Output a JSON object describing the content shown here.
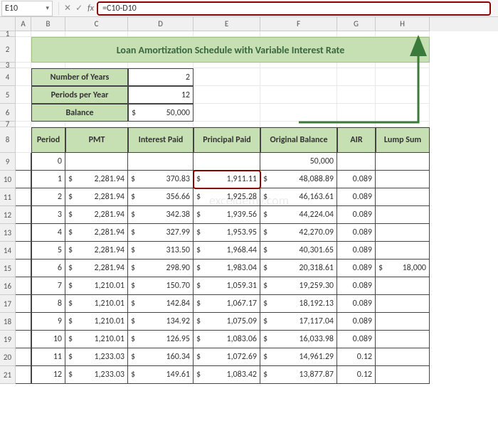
{
  "nameBox": "E10",
  "formula": "=C10-D10",
  "fx": "fx",
  "btnX": "✕",
  "btnV": "✓",
  "cols": {
    "A": "A",
    "B": "B",
    "C": "C",
    "D": "D",
    "E": "E",
    "F": "F",
    "G": "G",
    "H": "H"
  },
  "colWidths": {
    "A": 22,
    "B": 48,
    "C": 88,
    "D": 92,
    "E": 94,
    "F": 108,
    "G": 54,
    "H": 76
  },
  "title": "Loan Amortization Schedule with Variable Interest Rate",
  "params": {
    "numYears": {
      "label": "Number of Years",
      "value": "2"
    },
    "periodsPerYear": {
      "label": "Periods per Year",
      "value": "12"
    },
    "balance": {
      "label": "Balance",
      "cur": "$",
      "value": "50,000"
    }
  },
  "headers": {
    "period": "Period",
    "pmt": "PMT",
    "interest": "Interest Paid",
    "principal": "Principal Paid",
    "orig": "Original Balance",
    "air": "AIR",
    "lump": "Lump Sum"
  },
  "rowNums": [
    "1",
    "2",
    "3",
    "4",
    "5",
    "6",
    "7",
    "8",
    "9",
    "10",
    "11",
    "12",
    "13",
    "14",
    "15",
    "16",
    "17",
    "18",
    "19",
    "20",
    "21"
  ],
  "tableRows": [
    {
      "period": "0",
      "pmt": "",
      "interest": "",
      "principal": "",
      "orig": "50,000",
      "air": "",
      "lump": ""
    },
    {
      "period": "1",
      "pmt": "2,281.94",
      "interest": "370.83",
      "principal": "1,911.11",
      "orig": "48,088.89",
      "air": "0.089",
      "lump": ""
    },
    {
      "period": "2",
      "pmt": "2,281.94",
      "interest": "356.66",
      "principal": "1,925.28",
      "orig": "46,163.61",
      "air": "0.089",
      "lump": ""
    },
    {
      "period": "3",
      "pmt": "2,281.94",
      "interest": "342.38",
      "principal": "1,939.56",
      "orig": "44,224.04",
      "air": "0.089",
      "lump": ""
    },
    {
      "period": "4",
      "pmt": "2,281.94",
      "interest": "327.99",
      "principal": "1,953.95",
      "orig": "42,270.09",
      "air": "0.089",
      "lump": ""
    },
    {
      "period": "5",
      "pmt": "2,281.94",
      "interest": "313.50",
      "principal": "1,968.44",
      "orig": "40,301.65",
      "air": "0.089",
      "lump": ""
    },
    {
      "period": "6",
      "pmt": "2,281.94",
      "interest": "298.90",
      "principal": "1,983.04",
      "orig": "20,318.61",
      "air": "0.089",
      "lump": "18,000"
    },
    {
      "period": "7",
      "pmt": "1,210.01",
      "interest": "150.70",
      "principal": "1,059.31",
      "orig": "19,259.30",
      "air": "0.089",
      "lump": ""
    },
    {
      "period": "8",
      "pmt": "1,210.01",
      "interest": "142.84",
      "principal": "1,067.17",
      "orig": "18,192.13",
      "air": "0.089",
      "lump": ""
    },
    {
      "period": "9",
      "pmt": "1,210.01",
      "interest": "134.92",
      "principal": "1,075.09",
      "orig": "17,117.04",
      "air": "0.089",
      "lump": ""
    },
    {
      "period": "10",
      "pmt": "1,210.01",
      "interest": "126.95",
      "principal": "1,083.06",
      "orig": "16,033.98",
      "air": "0.089",
      "lump": ""
    },
    {
      "period": "11",
      "pmt": "1,233.03",
      "interest": "160.34",
      "principal": "1,072.69",
      "orig": "14,961.29",
      "air": "0.12",
      "lump": ""
    },
    {
      "period": "12",
      "pmt": "1,233.03",
      "interest": "149.61",
      "principal": "1,083.42",
      "orig": "13,877.87",
      "air": "0.12",
      "lump": ""
    }
  ],
  "currency": "$",
  "watermark": "exceldemy.com",
  "chart_data": {
    "type": "table",
    "title": "Loan Amortization Schedule with Variable Interest Rate",
    "parameters": {
      "Number of Years": 2,
      "Periods per Year": 12,
      "Balance": 50000
    },
    "columns": [
      "Period",
      "PMT",
      "Interest Paid",
      "Principal Paid",
      "Original Balance",
      "AIR",
      "Lump Sum"
    ],
    "rows": [
      [
        0,
        null,
        null,
        null,
        50000,
        null,
        null
      ],
      [
        1,
        2281.94,
        370.83,
        1911.11,
        48088.89,
        0.089,
        null
      ],
      [
        2,
        2281.94,
        356.66,
        1925.28,
        46163.61,
        0.089,
        null
      ],
      [
        3,
        2281.94,
        342.38,
        1939.56,
        44224.04,
        0.089,
        null
      ],
      [
        4,
        2281.94,
        327.99,
        1953.95,
        42270.09,
        0.089,
        null
      ],
      [
        5,
        2281.94,
        313.5,
        1968.44,
        40301.65,
        0.089,
        null
      ],
      [
        6,
        2281.94,
        298.9,
        1983.04,
        20318.61,
        0.089,
        18000
      ],
      [
        7,
        1210.01,
        150.7,
        1059.31,
        19259.3,
        0.089,
        null
      ],
      [
        8,
        1210.01,
        142.84,
        1067.17,
        18192.13,
        0.089,
        null
      ],
      [
        9,
        1210.01,
        134.92,
        1075.09,
        17117.04,
        0.089,
        null
      ],
      [
        10,
        1210.01,
        126.95,
        1083.06,
        16033.98,
        0.089,
        null
      ],
      [
        11,
        1233.03,
        160.34,
        1072.69,
        14961.29,
        0.12,
        null
      ],
      [
        12,
        1233.03,
        149.61,
        1083.42,
        13877.87,
        0.12,
        null
      ]
    ]
  }
}
